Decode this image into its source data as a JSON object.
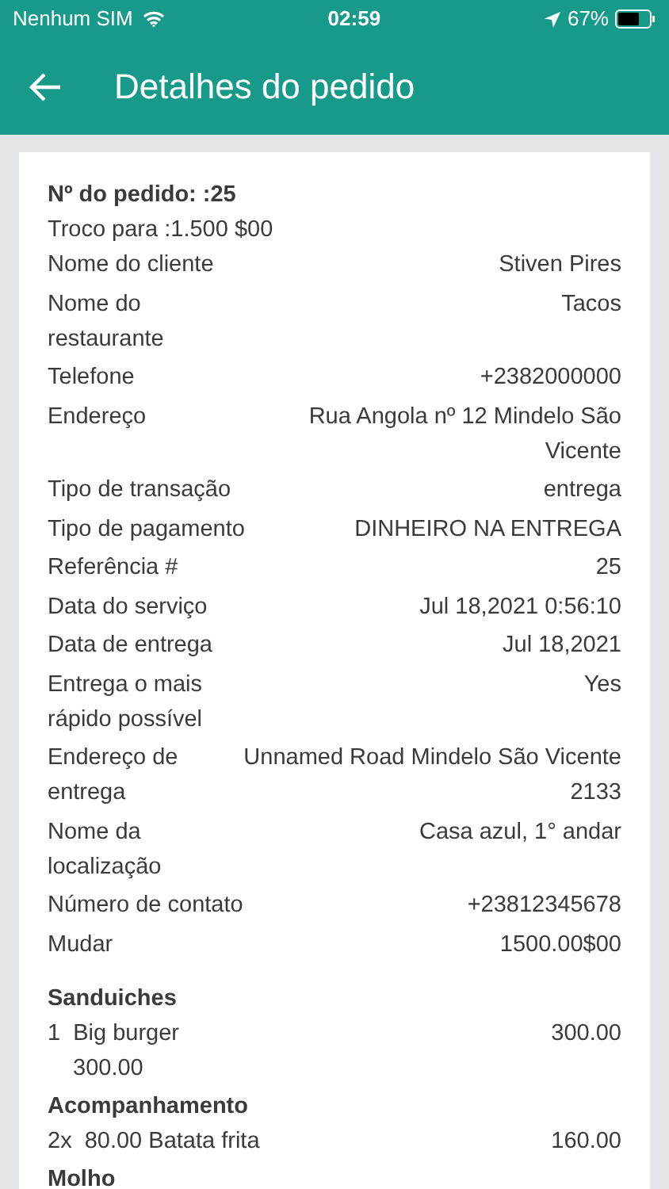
{
  "status_bar": {
    "carrier": "Nenhum SIM",
    "time": "02:59",
    "battery": "67%"
  },
  "header": {
    "title": "Detalhes do pedido"
  },
  "order": {
    "number": "Nº do pedido: :25",
    "change": "Troco para :1.500 $00",
    "details": [
      {
        "label": "Nome do cliente",
        "value": "Stiven Pires"
      },
      {
        "label": "Nome do restaurante",
        "value": "Tacos"
      },
      {
        "label": "Telefone",
        "value": "+2382000000"
      },
      {
        "label": "Endereço",
        "value": "Rua Angola nº 12 Mindelo São Vicente"
      },
      {
        "label": "Tipo de transação",
        "value": "entrega"
      },
      {
        "label": "Tipo de pagamento",
        "value": "DINHEIRO NA ENTREGA"
      },
      {
        "label": "Referência #",
        "value": "25"
      },
      {
        "label": "Data do serviço",
        "value": "Jul 18,2021 0:56:10"
      },
      {
        "label": "Data de entrega",
        "value": "Jul 18,2021"
      },
      {
        "label": "Entrega o mais rápido possível",
        "value": "Yes"
      },
      {
        "label": "Endereço de entrega",
        "value": "Unnamed Road Mindelo São Vicente 2133"
      },
      {
        "label": "Nome da localização",
        "value": "Casa azul, 1° andar"
      },
      {
        "label": "Número de contato",
        "value": "+23812345678"
      },
      {
        "label": "Mudar",
        "value": "1500.00$00"
      }
    ]
  },
  "sections": [
    {
      "title": "Sanduiches",
      "items": [
        {
          "qty": "1",
          "name": "Big burger",
          "total": "300.00",
          "sub": "300.00"
        }
      ]
    },
    {
      "title": "Acompanhamento",
      "items": [
        {
          "qty": "2x",
          "name": "80.00 Batata frita",
          "total": "160.00"
        }
      ]
    },
    {
      "title": "Molho"
    }
  ]
}
